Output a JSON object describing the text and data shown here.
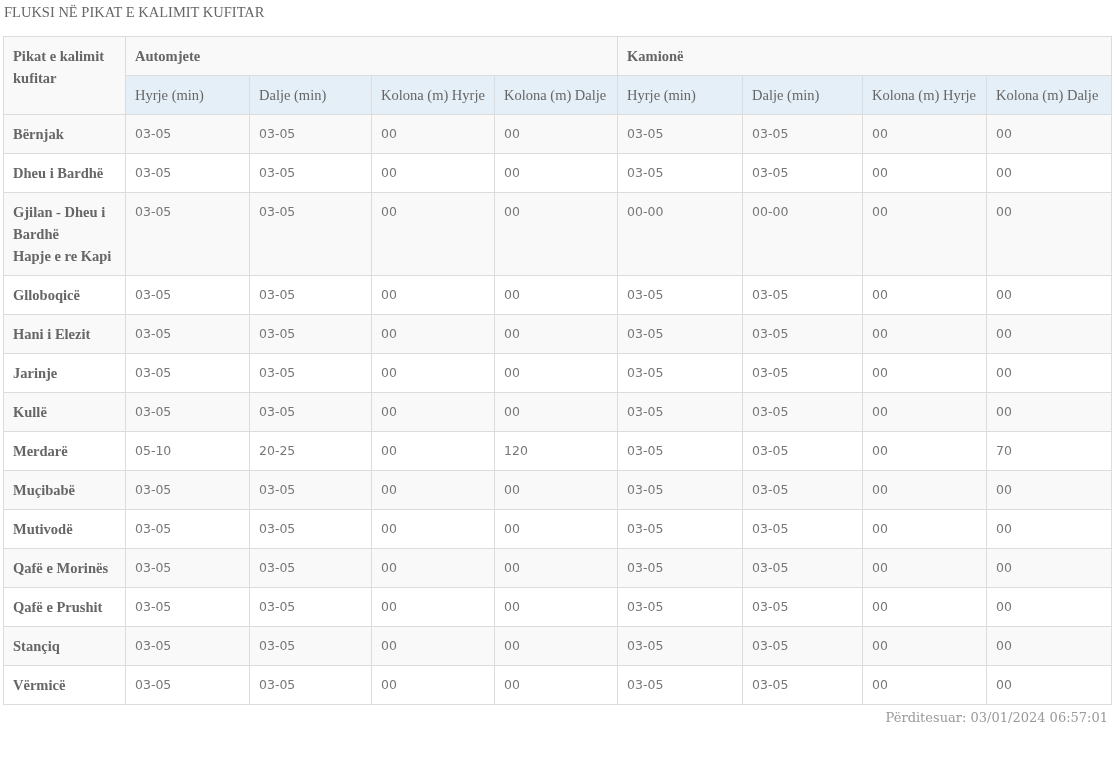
{
  "title": "FLUKSI NË PIKAT E KALIMIT KUFITAR",
  "table": {
    "corner_header": "Pikat e kalimit kufitar",
    "groups": [
      {
        "label": "Automjete",
        "columns": [
          "Hyrje (min)",
          "Dalje (min)",
          "Kolona (m) Hyrje",
          "Kolona (m) Dalje"
        ]
      },
      {
        "label": "Kamionë",
        "columns": [
          "Hyrje (min)",
          "Dalje (min)",
          "Kolona (m) Hyrje",
          "Kolona (m) Dalje"
        ]
      }
    ],
    "rows": [
      {
        "name": "Bërnjak",
        "values": [
          "03-05",
          "03-05",
          "00",
          "00",
          "03-05",
          "03-05",
          "00",
          "00"
        ]
      },
      {
        "name": "Dheu i Bardhë",
        "values": [
          "03-05",
          "03-05",
          "00",
          "00",
          "03-05",
          "03-05",
          "00",
          "00"
        ]
      },
      {
        "name": "Gjilan - Dheu i Bardhë\nHapje e re Kapi",
        "values": [
          "03-05",
          "03-05",
          "00",
          "00",
          "00-00",
          "00-00",
          "00",
          "00"
        ]
      },
      {
        "name": "Glloboqicë",
        "values": [
          "03-05",
          "03-05",
          "00",
          "00",
          "03-05",
          "03-05",
          "00",
          "00"
        ]
      },
      {
        "name": "Hani i Elezit",
        "values": [
          "03-05",
          "03-05",
          "00",
          "00",
          "03-05",
          "03-05",
          "00",
          "00"
        ]
      },
      {
        "name": "Jarinje",
        "values": [
          "03-05",
          "03-05",
          "00",
          "00",
          "03-05",
          "03-05",
          "00",
          "00"
        ]
      },
      {
        "name": "Kullë",
        "values": [
          "03-05",
          "03-05",
          "00",
          "00",
          "03-05",
          "03-05",
          "00",
          "00"
        ]
      },
      {
        "name": "Merdarë",
        "values": [
          "05-10",
          "20-25",
          "00",
          "120",
          "03-05",
          "03-05",
          "00",
          "70"
        ]
      },
      {
        "name": "Muçibabë",
        "values": [
          "03-05",
          "03-05",
          "00",
          "00",
          "03-05",
          "03-05",
          "00",
          "00"
        ]
      },
      {
        "name": "Mutivodë",
        "values": [
          "03-05",
          "03-05",
          "00",
          "00",
          "03-05",
          "03-05",
          "00",
          "00"
        ]
      },
      {
        "name": "Qafë e Morinës",
        "values": [
          "03-05",
          "03-05",
          "00",
          "00",
          "03-05",
          "03-05",
          "00",
          "00"
        ]
      },
      {
        "name": "Qafë e Prushit",
        "values": [
          "03-05",
          "03-05",
          "00",
          "00",
          "03-05",
          "03-05",
          "00",
          "00"
        ]
      },
      {
        "name": "Stançiq",
        "values": [
          "03-05",
          "03-05",
          "00",
          "00",
          "03-05",
          "03-05",
          "00",
          "00"
        ]
      },
      {
        "name": "Vërmicë",
        "values": [
          "03-05",
          "03-05",
          "00",
          "00",
          "03-05",
          "03-05",
          "00",
          "00"
        ]
      }
    ]
  },
  "updated": "Përditesuar: 03/01/2024 06:57:01"
}
